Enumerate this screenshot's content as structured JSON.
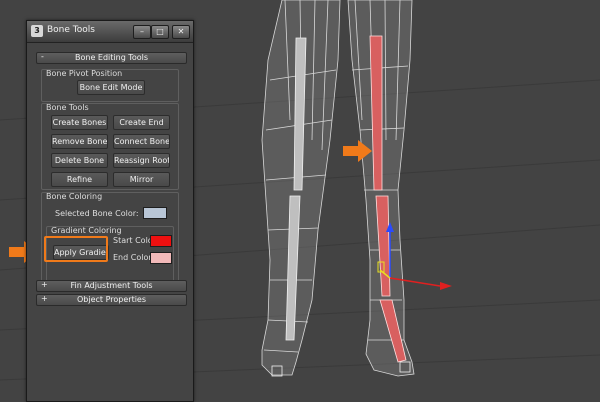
{
  "window": {
    "title": "Bone Tools",
    "logo": "3ds-max-logo",
    "controls": [
      "minimize-icon",
      "restore-icon",
      "close-icon"
    ]
  },
  "rollouts": {
    "bone_editing": {
      "sign": "-",
      "label": "Bone Editing Tools"
    },
    "fin_adjustment": {
      "sign": "+",
      "label": "Fin Adjustment Tools"
    },
    "object_properties": {
      "sign": "+",
      "label": "Object Properties"
    }
  },
  "bone_pivot": {
    "title": "Bone Pivot Position",
    "edit_mode_button": "Bone Edit Mode"
  },
  "bone_tools": {
    "title": "Bone Tools",
    "buttons": [
      "Create Bones",
      "Create End",
      "Remove Bone",
      "Connect Bones",
      "Delete Bone",
      "Reassign Root",
      "Refine",
      "Mirror"
    ]
  },
  "bone_coloring": {
    "title": "Bone Coloring",
    "selected_label": "Selected Bone Color:",
    "selected_color": "#b9c6d6",
    "gradient": {
      "title": "Gradient Coloring",
      "apply_button": "Apply Gradient",
      "start_label": "Start Color:",
      "start_color": "#ee1010",
      "end_label": "End Color:",
      "end_color": "#f2b9b9"
    }
  },
  "colors": {
    "annotation_orange": "#f07a1a",
    "viewport_bg": "#434343",
    "wireframe": "#cfcfcf"
  }
}
